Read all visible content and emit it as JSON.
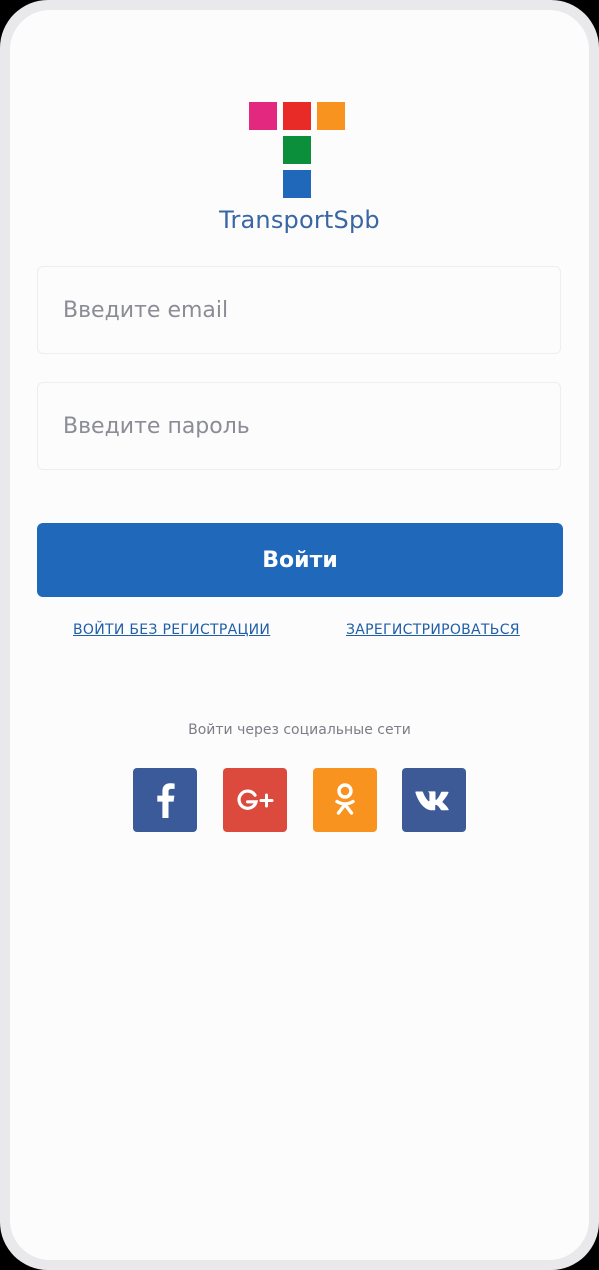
{
  "app": {
    "brand_name": "TransportSpb",
    "logo_colors": [
      "#e3287f",
      "#e82b27",
      "#f7931e",
      "#0c8f3a",
      "#1f68ba"
    ]
  },
  "form": {
    "email_placeholder": "Введите email",
    "email_value": "",
    "password_placeholder": "Введите пароль",
    "password_value": "",
    "login_label": "Войти"
  },
  "links": {
    "guest_label": "ВОЙТИ БЕЗ РЕГИСТРАЦИИ",
    "register_label": "ЗАРЕГИСТРИРОВАТЬСЯ"
  },
  "social": {
    "caption": "Войти через социальные сети",
    "buttons": [
      {
        "name": "facebook",
        "icon": "facebook-icon",
        "color": "#3b5a9a"
      },
      {
        "name": "google-plus",
        "icon": "google-plus-icon",
        "color": "#dc4a3d"
      },
      {
        "name": "odnoklassniki",
        "icon": "odnoklassniki-icon",
        "color": "#f7931e"
      },
      {
        "name": "vkontakte",
        "icon": "vk-icon",
        "color": "#3d5a97"
      }
    ]
  },
  "colors": {
    "primary": "#1f68ba",
    "link": "#1f5fa8",
    "brand_text": "#3a67a3"
  }
}
